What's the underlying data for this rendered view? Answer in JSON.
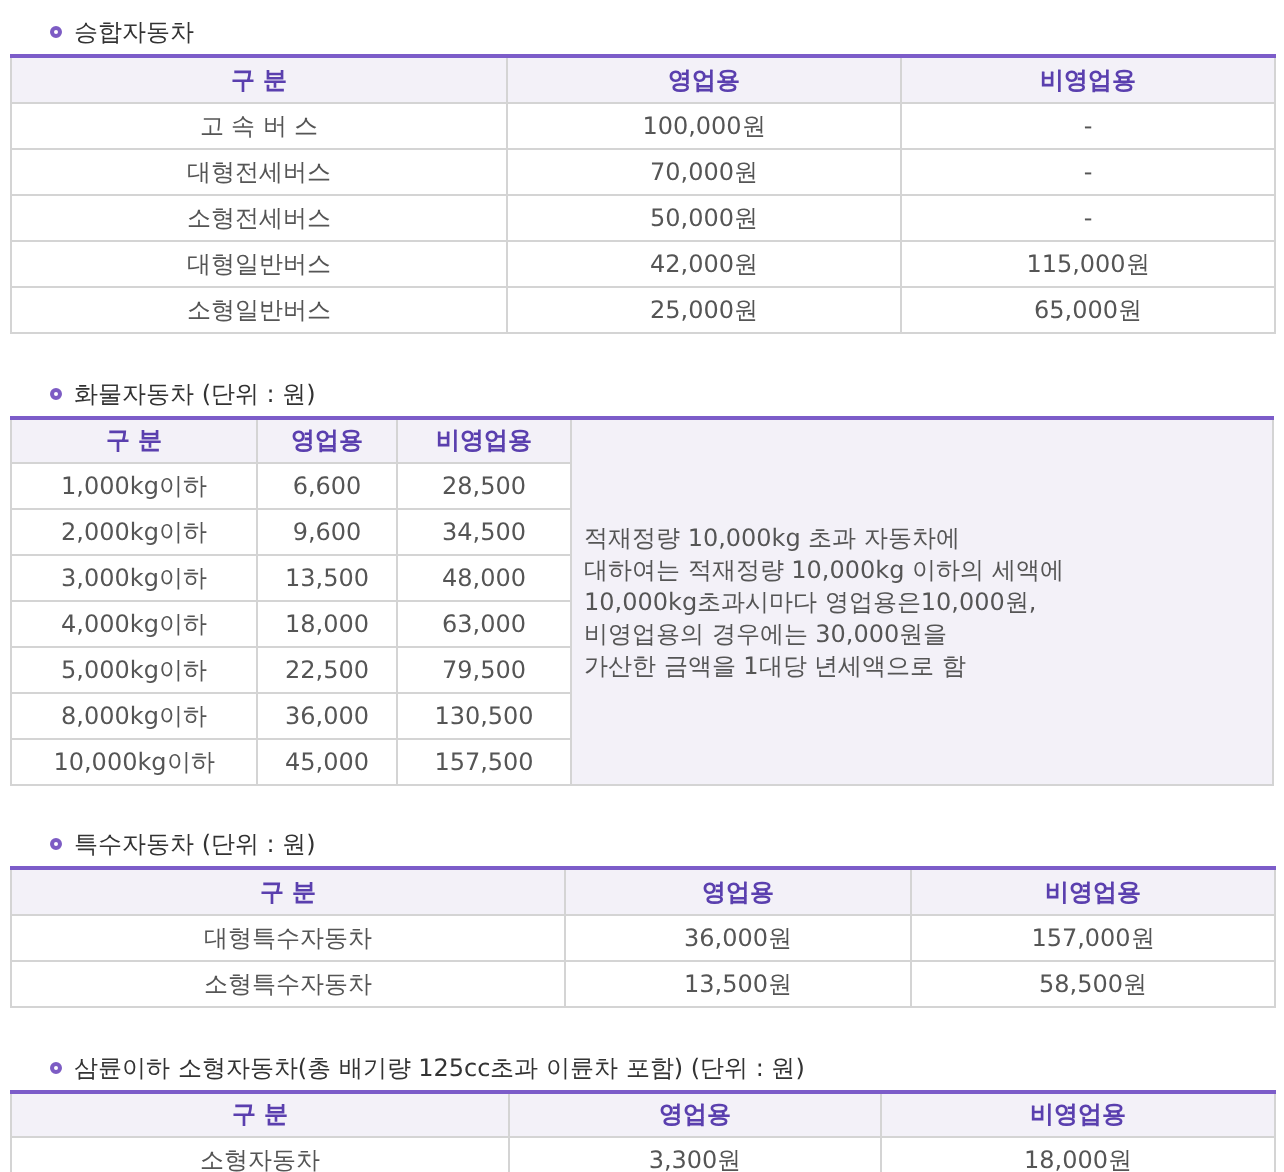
{
  "sections": [
    {
      "title": "승합자동차",
      "columns": [
        "구 분",
        "영업용",
        "비영업용"
      ],
      "rows": [
        [
          "고 속 버 스",
          "100,000원",
          "-"
        ],
        [
          "대형전세버스",
          "70,000원",
          "-"
        ],
        [
          "소형전세버스",
          "50,000원",
          "-"
        ],
        [
          "대형일반버스",
          "42,000원",
          "115,000원"
        ],
        [
          "소형일반버스",
          "25,000원",
          "65,000원"
        ]
      ]
    },
    {
      "title": "화물자동차 (단위 : 원)",
      "columns": [
        "구 분",
        "영업용",
        "비영업용"
      ],
      "rows": [
        [
          "1,000kg이하",
          "6,600",
          "28,500"
        ],
        [
          "2,000kg이하",
          "9,600",
          "34,500"
        ],
        [
          "3,000kg이하",
          "13,500",
          "48,000"
        ],
        [
          "4,000kg이하",
          "18,000",
          "63,000"
        ],
        [
          "5,000kg이하",
          "22,500",
          "79,500"
        ],
        [
          "8,000kg이하",
          "36,000",
          "130,500"
        ],
        [
          "10,000kg이하",
          "45,000",
          "157,500"
        ]
      ],
      "note": [
        "적재정량 10,000kg 초과 자동차에",
        "대하여는 적재정량 10,000kg 이하의 세액에",
        "10,000kg초과시마다 영업용은10,000원,",
        "비영업용의 경우에는 30,000원을",
        "가산한 금액을 1대당 년세액으로 함"
      ]
    },
    {
      "title": "특수자동차 (단위 : 원)",
      "columns": [
        "구 분",
        "영업용",
        "비영업용"
      ],
      "rows": [
        [
          "대형특수자동차",
          "36,000원",
          "157,000원"
        ],
        [
          "소형특수자동차",
          "13,500원",
          "58,500원"
        ]
      ]
    },
    {
      "title": "삼륜이하 소형자동차(총 배기량 125cc초과 이륜차 포함) (단위 : 원)",
      "columns": [
        "구 분",
        "영업용",
        "비영업용"
      ],
      "rows": [
        [
          "소형자동차",
          "3,300원",
          "18,000원"
        ]
      ]
    }
  ]
}
